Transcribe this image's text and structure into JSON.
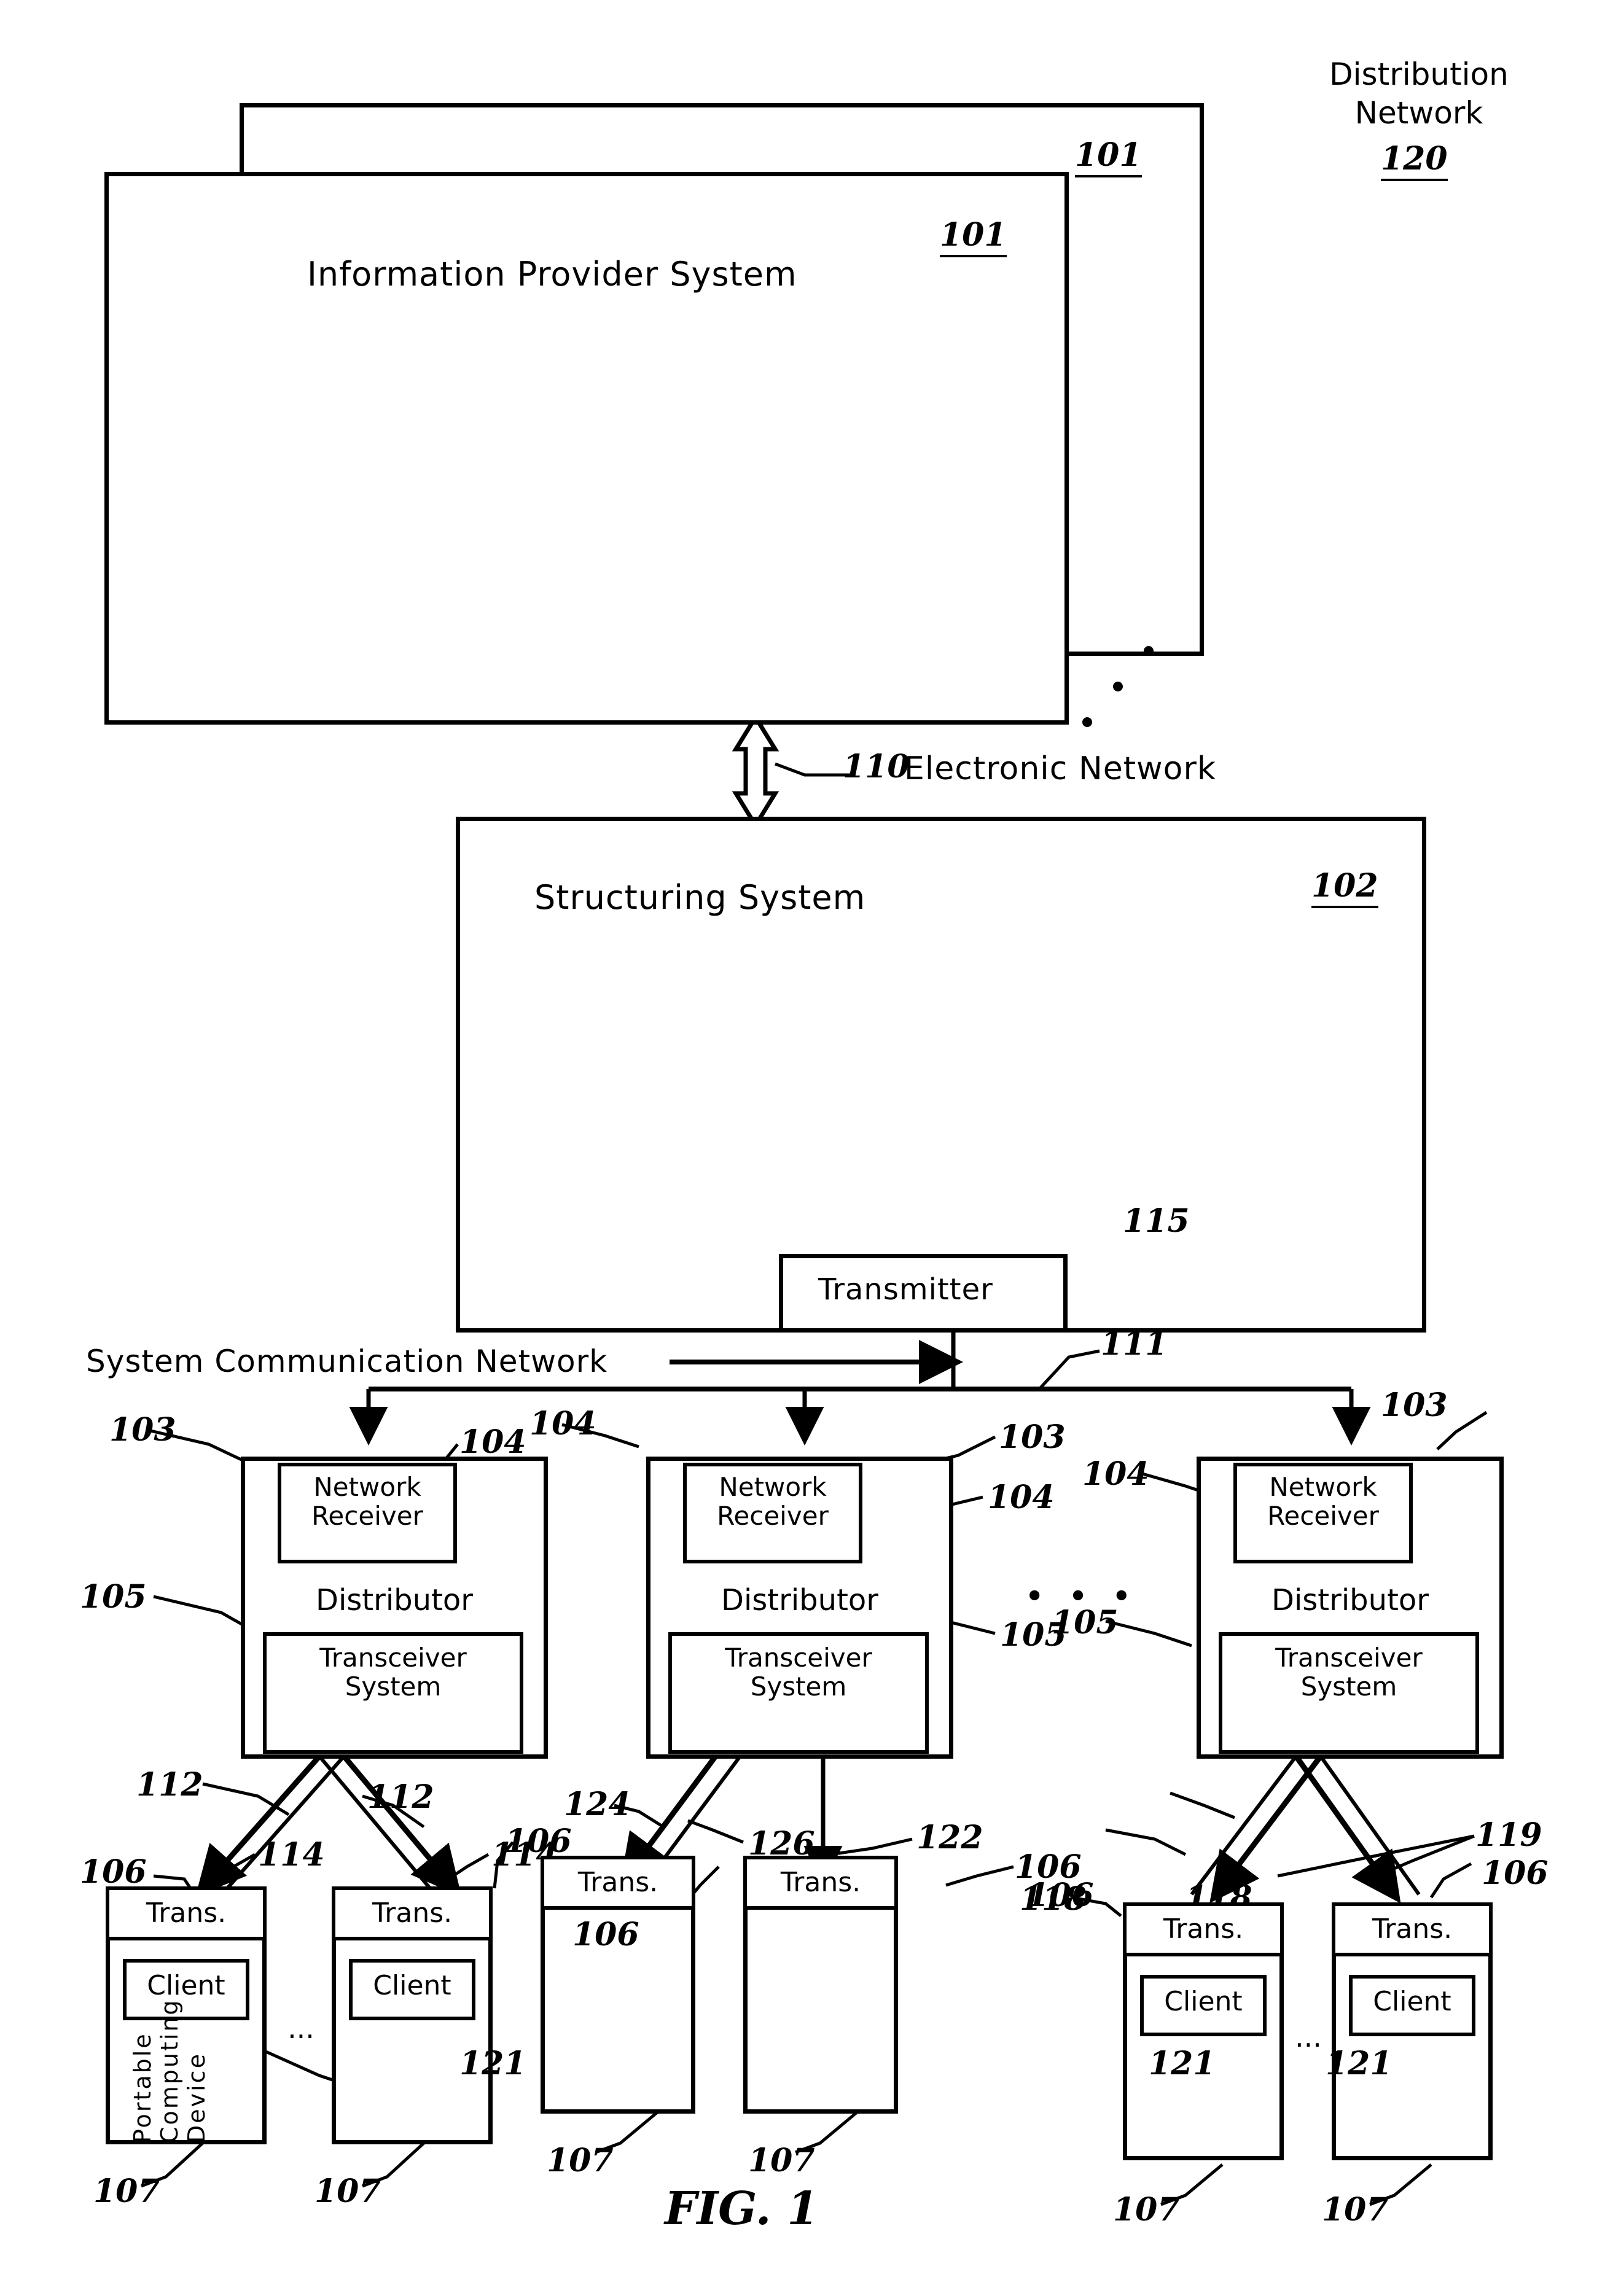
{
  "figure": {
    "caption": "FIG. 1",
    "title_blocks": {
      "distribution_network_line1": "Distribution",
      "distribution_network_line2": "Network",
      "distribution_network_ref": "120"
    }
  },
  "information_provider": {
    "label": "Information Provider System",
    "ref_front": "101",
    "ref_back": "101",
    "ellipsis": "• • •"
  },
  "electronic_network": {
    "ref": "110",
    "label": "Electronic Network"
  },
  "structuring_system": {
    "label": "Structuring System",
    "ref": "102",
    "transmitter": {
      "label": "Transmitter",
      "ref": "115"
    }
  },
  "system_communication_network": {
    "label": "System Communication Network",
    "ref": "111"
  },
  "distributors": [
    {
      "label": "Distributor",
      "ref": "103",
      "network_receiver": {
        "label_line1": "Network",
        "label_line2": "Receiver",
        "ref": "104"
      },
      "transceiver": {
        "label_line1": "Transceiver",
        "label_line2": "System",
        "ref": "105"
      },
      "link_refs": [
        "112",
        "112",
        "114",
        "114"
      ]
    },
    {
      "label": "Distributor",
      "ref": "103",
      "network_receiver": {
        "label_line1": "Network",
        "label_line2": "Receiver",
        "ref": "104"
      },
      "transceiver": {
        "label_line1": "Transceiver",
        "label_line2": "System",
        "ref": "105"
      },
      "link_refs": [
        "124",
        "126",
        "122"
      ]
    },
    {
      "label": "Distributor",
      "ref": "103",
      "network_receiver": {
        "label_line1": "Network",
        "label_line2": "Receiver",
        "ref": "104"
      },
      "transceiver": {
        "label_line1": "Transceiver",
        "label_line2": "System",
        "ref": "105"
      },
      "link_refs": [
        "118",
        "118",
        "119"
      ]
    }
  ],
  "distributor_ellipsis": "•   •   •",
  "client_devices": [
    {
      "trans_label": "Trans.",
      "trans_ref": "106",
      "client_label": "Client",
      "client_ref": "121",
      "device_label": "Portable Computing Device",
      "device_ref": "107"
    },
    {
      "trans_label": "Trans.",
      "trans_ref": "106",
      "client_label": "Client",
      "client_ref": "121",
      "device_label": "",
      "device_ref": "107"
    },
    {
      "trans_label": "Trans.",
      "trans_ref": "106",
      "client_label": "",
      "client_ref": "",
      "device_label": "",
      "device_ref": "107"
    },
    {
      "trans_label": "Trans.",
      "trans_ref": "106",
      "client_label": "",
      "client_ref": "",
      "device_label": "",
      "device_ref": "107"
    },
    {
      "trans_label": "Trans.",
      "trans_ref": "106",
      "client_label": "Client",
      "client_ref": "121",
      "device_label": "",
      "device_ref": "107"
    },
    {
      "trans_label": "Trans.",
      "trans_ref": "106",
      "client_label": "Client",
      "client_ref": "121",
      "device_label": "",
      "device_ref": "107"
    }
  ],
  "group_ellipsis": "...",
  "colors": {
    "ink": "#000000",
    "paper": "#ffffff"
  }
}
